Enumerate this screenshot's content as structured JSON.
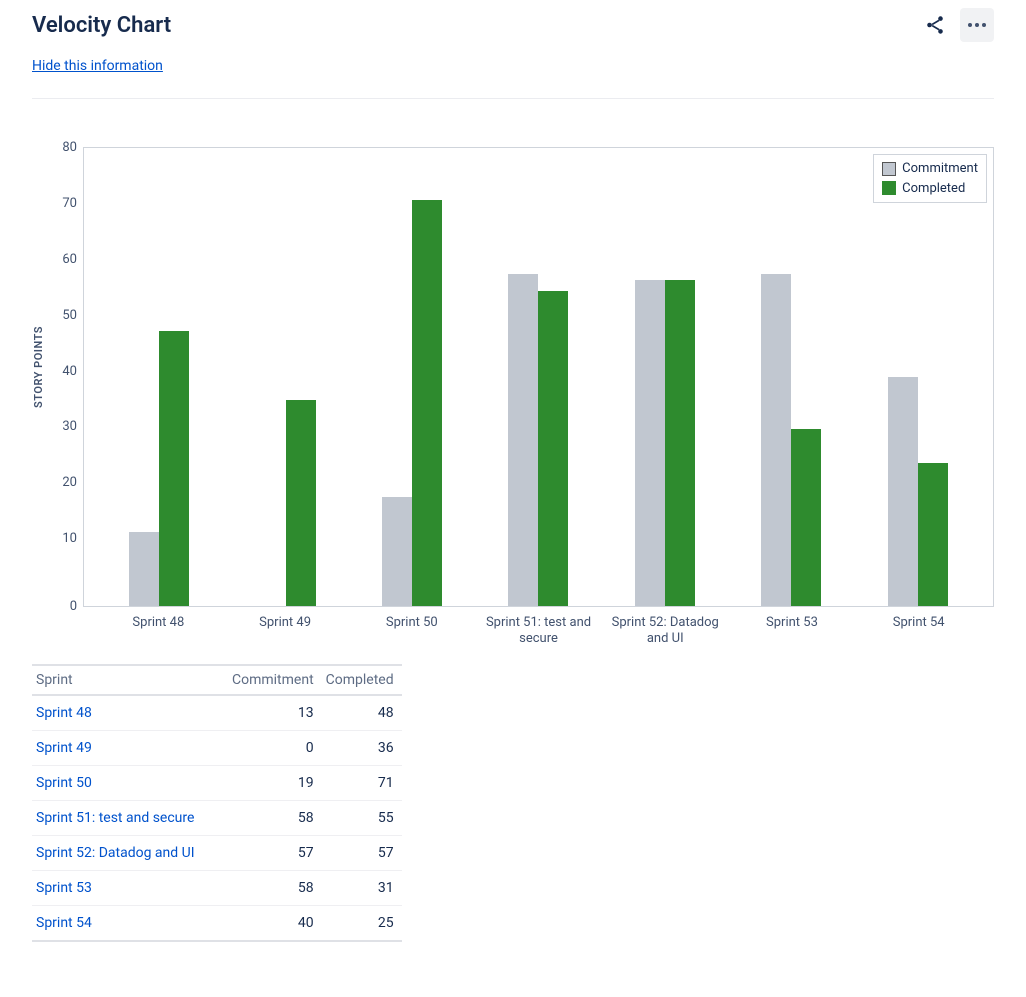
{
  "title": "Velocity Chart",
  "hide_info_label": "Hide this information",
  "legend": {
    "commitment": "Commitment",
    "completed": "Completed"
  },
  "chart_data": {
    "type": "bar",
    "ylabel": "STORY POINTS",
    "ylim": [
      0,
      80
    ],
    "yticks": [
      80,
      70,
      60,
      50,
      40,
      30,
      20,
      10,
      0
    ],
    "categories": [
      "Sprint 48",
      "Sprint 49",
      "Sprint 50",
      "Sprint 51: test and secure",
      "Sprint 52: Datadog and UI",
      "Sprint 53",
      "Sprint 54"
    ],
    "series": [
      {
        "name": "Commitment",
        "values": [
          13,
          0,
          19,
          58,
          57,
          58,
          40
        ]
      },
      {
        "name": "Completed",
        "values": [
          48,
          36,
          71,
          55,
          57,
          31,
          25
        ]
      }
    ]
  },
  "table": {
    "headers": {
      "sprint": "Sprint",
      "commitment": "Commitment",
      "completed": "Completed"
    },
    "rows": [
      {
        "sprint": "Sprint 48",
        "commitment": 13,
        "completed": 48
      },
      {
        "sprint": "Sprint 49",
        "commitment": 0,
        "completed": 36
      },
      {
        "sprint": "Sprint 50",
        "commitment": 19,
        "completed": 71
      },
      {
        "sprint": "Sprint 51: test and secure",
        "commitment": 58,
        "completed": 55
      },
      {
        "sprint": "Sprint 52: Datadog and UI",
        "commitment": 57,
        "completed": 57
      },
      {
        "sprint": "Sprint 53",
        "commitment": 58,
        "completed": 31
      },
      {
        "sprint": "Sprint 54",
        "commitment": 40,
        "completed": 25
      }
    ]
  }
}
